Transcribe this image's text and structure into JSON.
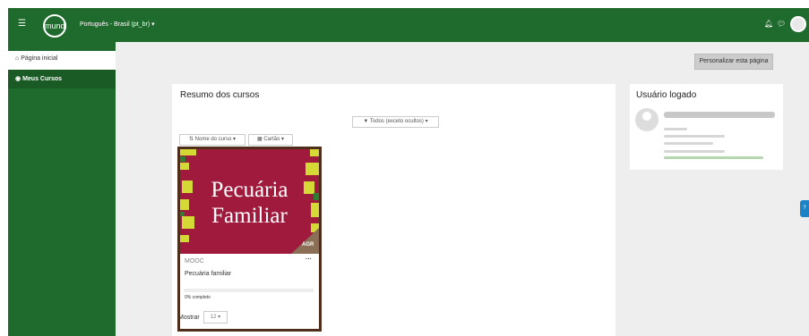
{
  "navbar": {
    "menu_icon": "hamburger-icon",
    "logo_text": "mundi",
    "language": "Português - Brasil (pt_br) ▾",
    "bell_icon": "bell-icon",
    "chat_icon": "chat-icon"
  },
  "sidebar": {
    "items": [
      {
        "icon": "home-icon",
        "label": "Página inicial"
      },
      {
        "icon": "dashboard-icon",
        "label": "Meus Cursos"
      }
    ]
  },
  "header": {
    "customize_button": "Personalizar esta página"
  },
  "courses_overview": {
    "title": "Resumo dos cursos",
    "filter_label": "Todos (exceto ocultos) ▾",
    "sort_label": "Nome do curso ▾",
    "view_label": "Cartão ▾",
    "courses": [
      {
        "image_title": "Pecuária Familiar",
        "tag": "AGR",
        "category": "MOOC",
        "name": "Pecuária familiar",
        "progress_text": "0% completo",
        "progress": 0
      }
    ],
    "show_label": "Mostrar",
    "show_value": "12 ▾"
  },
  "logged_user": {
    "title": "Usuário logado"
  },
  "colors": {
    "navbar": "#1f6b2d",
    "course_image_bg": "#a01a3d",
    "course_image_accent": "#d4d935",
    "card_border": "#4e2e1a",
    "help_button": "#1b83c6"
  }
}
